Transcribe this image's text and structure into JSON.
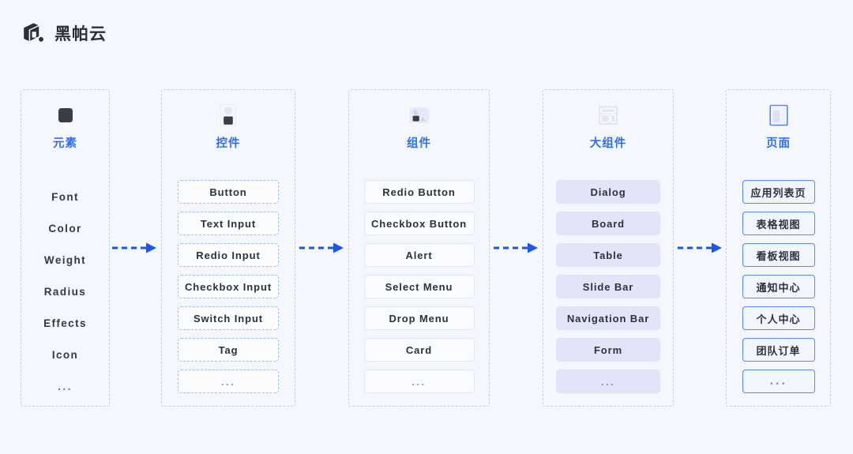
{
  "brand": {
    "name": "黑帕云",
    "logo_icon": "hepa-cloud-logo-icon",
    "logo_color": "#2b2f36"
  },
  "theme": {
    "background": "#f4f7fd",
    "accent_blue": "#2f6ef0",
    "column_border": "#c5cee0",
    "chip_dashed_border": "#9fbcf2",
    "chip_solid_border": "#e2e6ef",
    "chip_fill_bg": "#e2e5f8",
    "chip_blue_border": "#5b86ef",
    "text_dark": "#2b323d"
  },
  "arrows": [
    {
      "label": "arrow-elements-to-widgets",
      "color": "#2f6ef0",
      "style": "dashed"
    },
    {
      "label": "arrow-widgets-to-components",
      "color": "#2f6ef0",
      "style": "dashed"
    },
    {
      "label": "arrow-components-to-large-components",
      "color": "#2f6ef0",
      "style": "dashed"
    },
    {
      "label": "arrow-large-components-to-pages",
      "color": "#2f6ef0",
      "style": "dashed"
    }
  ],
  "columns": [
    {
      "id": "elements",
      "title": "元素",
      "icon": "dark-rounded-square-icon",
      "style": "plain",
      "items": [
        {
          "label": "Font"
        },
        {
          "label": "Color"
        },
        {
          "label": "Weight"
        },
        {
          "label": "Radius"
        },
        {
          "label": "Effects"
        },
        {
          "label": "Icon"
        },
        {
          "label": "..."
        }
      ]
    },
    {
      "id": "widgets",
      "title": "控件",
      "icon": "circle-over-square-dashed-icon",
      "style": "dashed",
      "items": [
        {
          "label": "Button"
        },
        {
          "label": "Text Input"
        },
        {
          "label": "Redio Input"
        },
        {
          "label": "Checkbox Input"
        },
        {
          "label": "Switch Input"
        },
        {
          "label": "Tag"
        },
        {
          "label": "..."
        }
      ]
    },
    {
      "id": "components",
      "title": "组件",
      "icon": "shapes-group-card-icon",
      "style": "solid",
      "items": [
        {
          "label": "Redio Button"
        },
        {
          "label": "Checkbox Button"
        },
        {
          "label": "Alert"
        },
        {
          "label": "Select Menu"
        },
        {
          "label": "Drop Menu"
        },
        {
          "label": "Card"
        },
        {
          "label": "..."
        }
      ]
    },
    {
      "id": "large-components",
      "title": "大组件",
      "icon": "layout-panels-icon",
      "style": "fill",
      "items": [
        {
          "label": "Dialog"
        },
        {
          "label": "Board"
        },
        {
          "label": "Table"
        },
        {
          "label": "Slide Bar"
        },
        {
          "label": "Navigation Bar"
        },
        {
          "label": "Form"
        },
        {
          "label": "..."
        }
      ]
    },
    {
      "id": "pages",
      "title": "页面",
      "icon": "page-layout-blue-icon",
      "style": "blue",
      "items": [
        {
          "label": "应用列表页"
        },
        {
          "label": "表格视图"
        },
        {
          "label": "看板视图"
        },
        {
          "label": "通知中心"
        },
        {
          "label": "个人中心"
        },
        {
          "label": "团队订单"
        },
        {
          "label": "..."
        }
      ]
    }
  ]
}
